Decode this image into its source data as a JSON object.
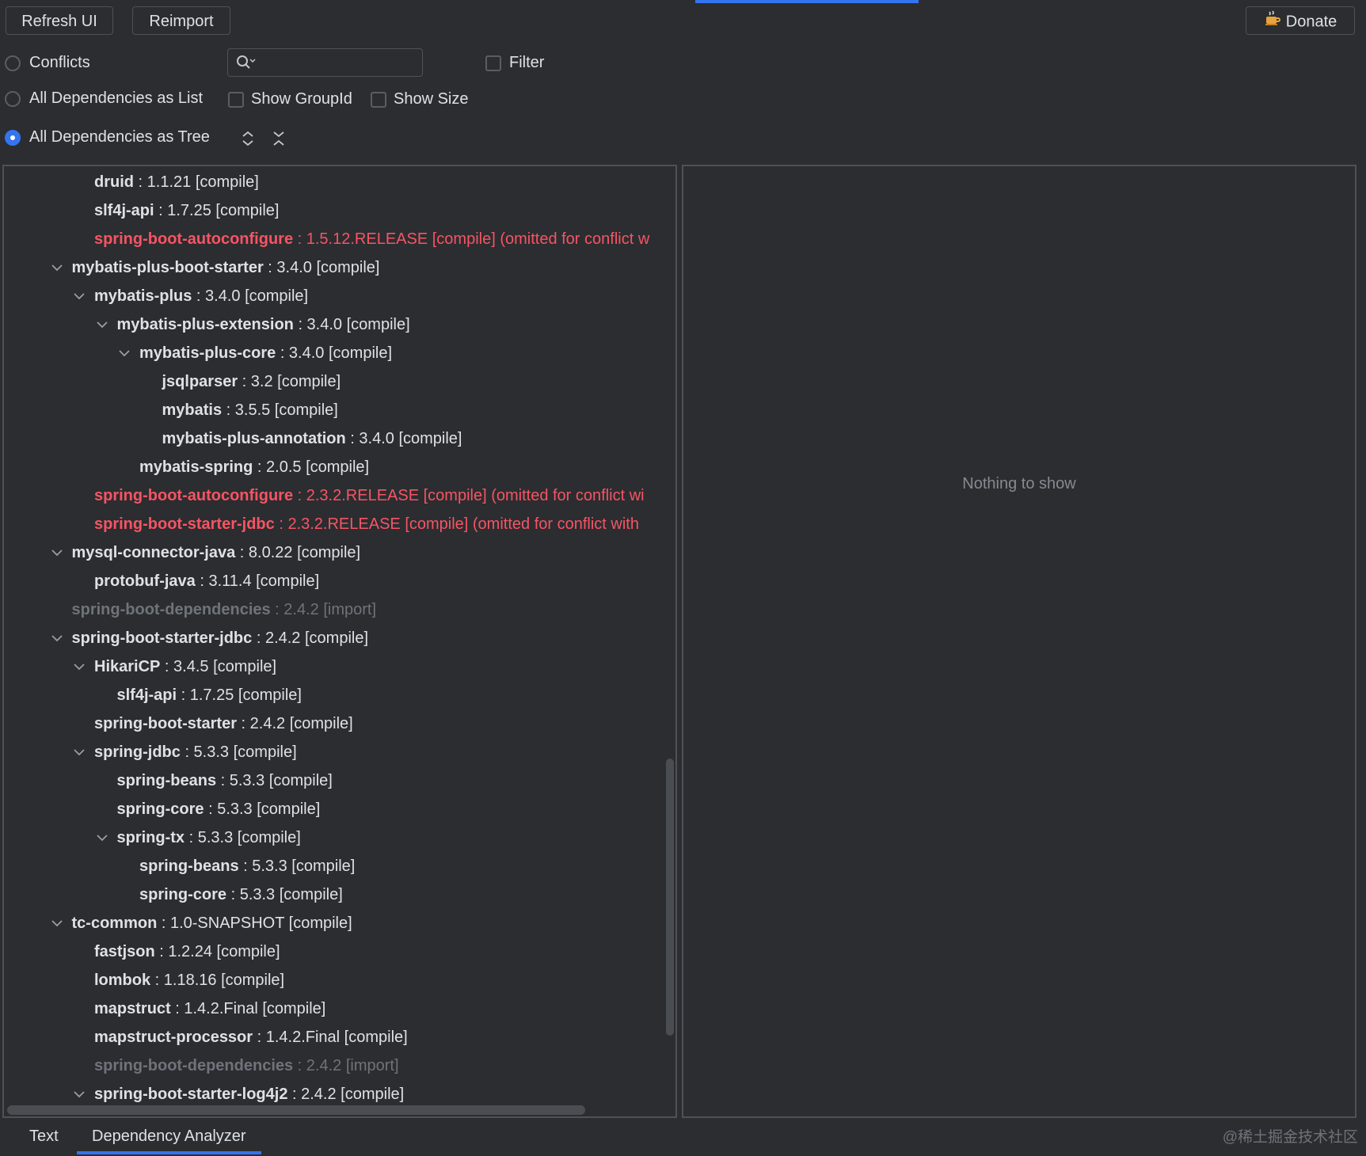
{
  "toolbar": {
    "refresh_label": "Refresh UI",
    "reimport_label": "Reimport",
    "donate_label": "Donate"
  },
  "options": {
    "conflicts_label": "Conflicts",
    "list_label": "All Dependencies as List",
    "tree_label": "All Dependencies as Tree",
    "selected_mode": "All Dependencies as Tree",
    "filter_label": "Filter",
    "show_groupid_label": "Show GroupId",
    "show_size_label": "Show Size",
    "search_value": ""
  },
  "tree": [
    {
      "depth": 2,
      "expanded": null,
      "status": "normal",
      "name": "druid",
      "detail": " : 1.1.21 [compile]"
    },
    {
      "depth": 2,
      "expanded": null,
      "status": "normal",
      "name": "slf4j-api",
      "detail": " : 1.7.25 [compile]"
    },
    {
      "depth": 2,
      "expanded": null,
      "status": "conflict",
      "name": "spring-boot-autoconfigure",
      "detail": " : 1.5.12.RELEASE [compile] (omitted for conflict w"
    },
    {
      "depth": 1,
      "expanded": true,
      "status": "normal",
      "name": "mybatis-plus-boot-starter",
      "detail": " : 3.4.0 [compile]"
    },
    {
      "depth": 2,
      "expanded": true,
      "status": "normal",
      "name": "mybatis-plus",
      "detail": " : 3.4.0 [compile]"
    },
    {
      "depth": 3,
      "expanded": true,
      "status": "normal",
      "name": "mybatis-plus-extension",
      "detail": " : 3.4.0 [compile]"
    },
    {
      "depth": 4,
      "expanded": true,
      "status": "normal",
      "name": "mybatis-plus-core",
      "detail": " : 3.4.0 [compile]"
    },
    {
      "depth": 5,
      "expanded": null,
      "status": "normal",
      "name": "jsqlparser",
      "detail": " : 3.2 [compile]"
    },
    {
      "depth": 5,
      "expanded": null,
      "status": "normal",
      "name": "mybatis",
      "detail": " : 3.5.5 [compile]"
    },
    {
      "depth": 5,
      "expanded": null,
      "status": "normal",
      "name": "mybatis-plus-annotation",
      "detail": " : 3.4.0 [compile]"
    },
    {
      "depth": 4,
      "expanded": null,
      "status": "normal",
      "name": "mybatis-spring",
      "detail": " : 2.0.5 [compile]"
    },
    {
      "depth": 2,
      "expanded": null,
      "status": "conflict",
      "name": "spring-boot-autoconfigure",
      "detail": " : 2.3.2.RELEASE [compile] (omitted for conflict wi"
    },
    {
      "depth": 2,
      "expanded": null,
      "status": "conflict",
      "name": "spring-boot-starter-jdbc",
      "detail": " : 2.3.2.RELEASE [compile] (omitted for conflict with"
    },
    {
      "depth": 1,
      "expanded": true,
      "status": "normal",
      "name": "mysql-connector-java",
      "detail": " : 8.0.22 [compile]"
    },
    {
      "depth": 2,
      "expanded": null,
      "status": "normal",
      "name": "protobuf-java",
      "detail": " : 3.11.4 [compile]"
    },
    {
      "depth": 1,
      "expanded": null,
      "status": "import",
      "name": "spring-boot-dependencies",
      "detail": " : 2.4.2 [import]"
    },
    {
      "depth": 1,
      "expanded": true,
      "status": "normal",
      "name": "spring-boot-starter-jdbc",
      "detail": " : 2.4.2 [compile]"
    },
    {
      "depth": 2,
      "expanded": true,
      "status": "normal",
      "name": "HikariCP",
      "detail": " : 3.4.5 [compile]"
    },
    {
      "depth": 3,
      "expanded": null,
      "status": "normal",
      "name": "slf4j-api",
      "detail": " : 1.7.25 [compile]"
    },
    {
      "depth": 2,
      "expanded": null,
      "status": "normal",
      "name": "spring-boot-starter",
      "detail": " : 2.4.2 [compile]"
    },
    {
      "depth": 2,
      "expanded": true,
      "status": "normal",
      "name": "spring-jdbc",
      "detail": " : 5.3.3 [compile]"
    },
    {
      "depth": 3,
      "expanded": null,
      "status": "normal",
      "name": "spring-beans",
      "detail": " : 5.3.3 [compile]"
    },
    {
      "depth": 3,
      "expanded": null,
      "status": "normal",
      "name": "spring-core",
      "detail": " : 5.3.3 [compile]"
    },
    {
      "depth": 3,
      "expanded": true,
      "status": "normal",
      "name": "spring-tx",
      "detail": " : 5.3.3 [compile]"
    },
    {
      "depth": 4,
      "expanded": null,
      "status": "normal",
      "name": "spring-beans",
      "detail": " : 5.3.3 [compile]"
    },
    {
      "depth": 4,
      "expanded": null,
      "status": "normal",
      "name": "spring-core",
      "detail": " : 5.3.3 [compile]"
    },
    {
      "depth": 1,
      "expanded": true,
      "status": "normal",
      "name": "tc-common",
      "detail": " : 1.0-SNAPSHOT [compile]"
    },
    {
      "depth": 2,
      "expanded": null,
      "status": "normal",
      "name": "fastjson",
      "detail": " : 1.2.24 [compile]"
    },
    {
      "depth": 2,
      "expanded": null,
      "status": "normal",
      "name": "lombok",
      "detail": " : 1.18.16 [compile]"
    },
    {
      "depth": 2,
      "expanded": null,
      "status": "normal",
      "name": "mapstruct",
      "detail": " : 1.4.2.Final [compile]"
    },
    {
      "depth": 2,
      "expanded": null,
      "status": "normal",
      "name": "mapstruct-processor",
      "detail": " : 1.4.2.Final [compile]"
    },
    {
      "depth": 2,
      "expanded": null,
      "status": "import",
      "name": "spring-boot-dependencies",
      "detail": " : 2.4.2 [import]"
    },
    {
      "depth": 2,
      "expanded": true,
      "status": "normal",
      "name": "spring-boot-starter-log4j2",
      "detail": " : 2.4.2 [compile]"
    }
  ],
  "detail_panel": {
    "empty_text": "Nothing to show"
  },
  "tabs": [
    {
      "label": "Text",
      "active": false
    },
    {
      "label": "Dependency Analyzer",
      "active": true
    }
  ],
  "watermark": "@稀土掘金技术社区",
  "colors": {
    "accent": "#3574f0",
    "conflict": "#f75464",
    "import": "#6f737a",
    "background": "#2b2d30"
  }
}
